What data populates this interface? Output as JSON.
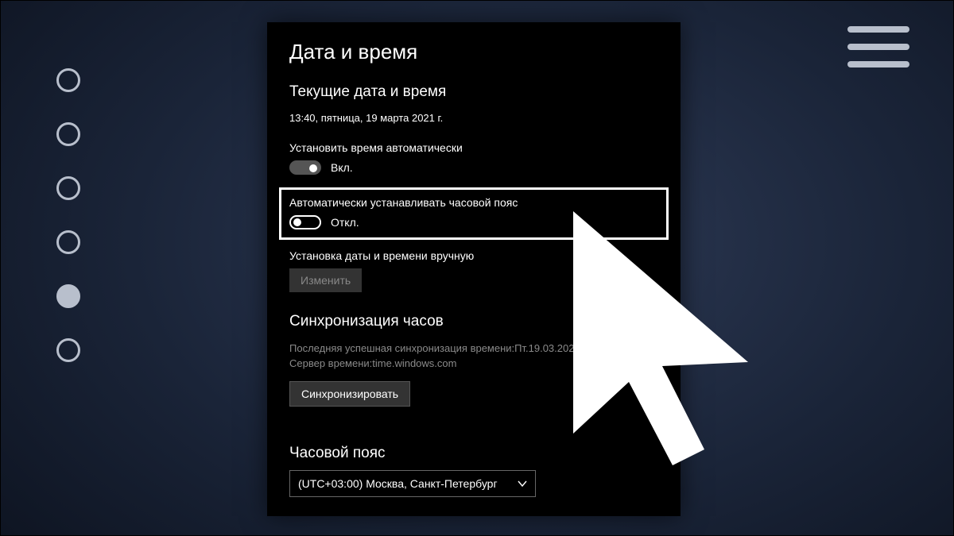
{
  "panel": {
    "title": "Дата и время",
    "current_heading": "Текущие дата и время",
    "current_value": "13:40, пятница, 19 марта 2021 г.",
    "auto_time": {
      "label": "Установить время автоматически",
      "state": "Вкл."
    },
    "auto_tz": {
      "label": "Автоматически устанавливать часовой пояс",
      "state": "Откл."
    },
    "manual": {
      "label": "Установка даты и времени вручную",
      "button": "Изменить"
    },
    "sync": {
      "heading": "Синхронизация часов",
      "last_line": "Последняя успешная синхронизация времени:Пт.19.03.2021 10:43",
      "server_line": "Сервер времени:time.windows.com",
      "button": "Синхронизировать"
    },
    "timezone": {
      "heading": "Часовой пояс",
      "selected": "(UTC+03:00) Москва, Санкт-Петербург"
    }
  }
}
